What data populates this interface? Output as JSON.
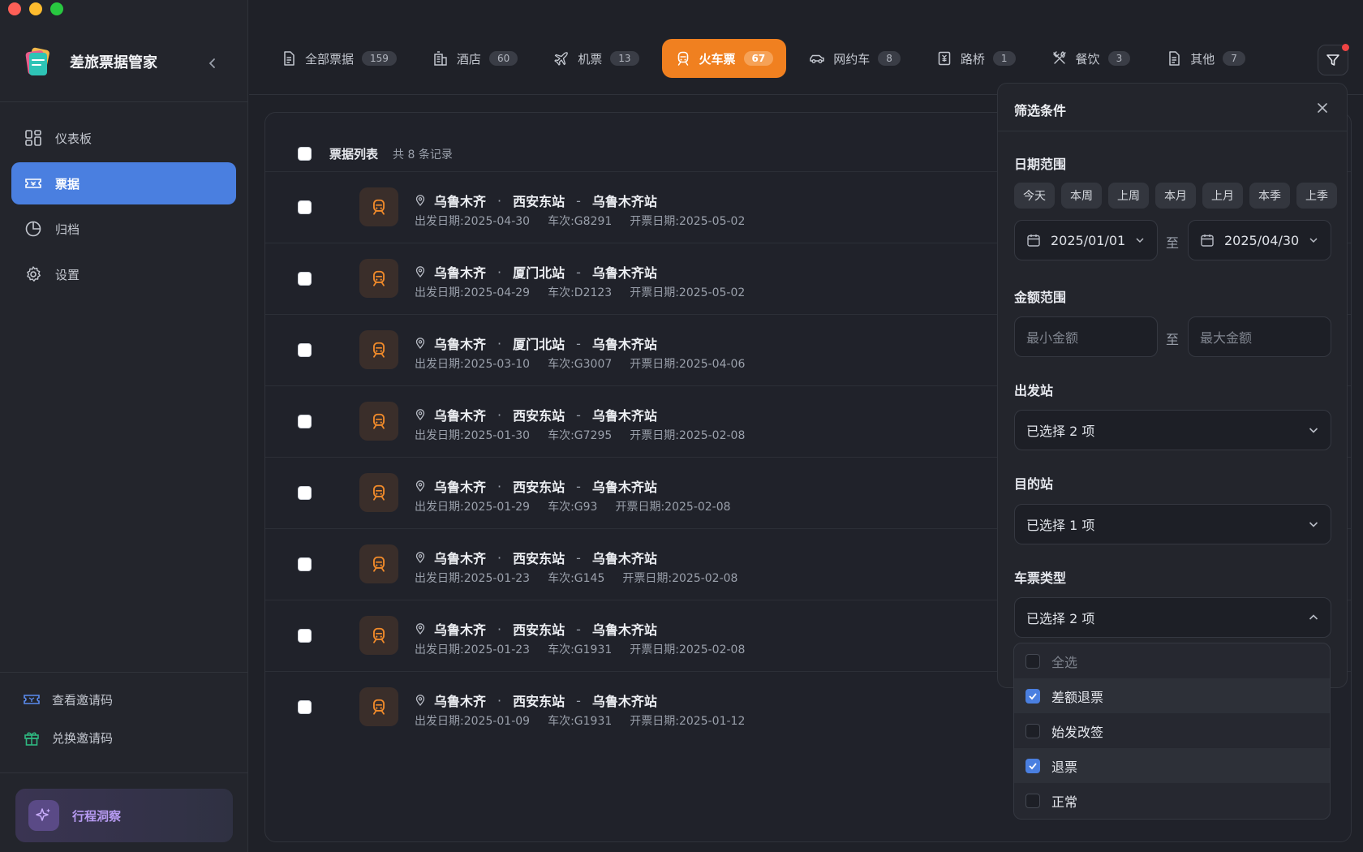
{
  "app": {
    "title": "差旅票据管家"
  },
  "sidebar": {
    "items": [
      {
        "label": "仪表板",
        "icon": "dashboard-icon",
        "active": false
      },
      {
        "label": "票据",
        "icon": "ticket-icon",
        "active": true
      },
      {
        "label": "归档",
        "icon": "pie-icon",
        "active": false
      },
      {
        "label": "设置",
        "icon": "gear-icon",
        "active": false
      }
    ],
    "bottom_links": [
      {
        "label": "查看邀请码",
        "icon": "ticket-icon"
      },
      {
        "label": "兑换邀请码",
        "icon": "gift-icon"
      }
    ],
    "insight_label": "行程洞察"
  },
  "tabs": [
    {
      "label": "全部票据",
      "count": "159",
      "icon": "document-icon",
      "active": false
    },
    {
      "label": "酒店",
      "count": "60",
      "icon": "hotel-icon",
      "active": false
    },
    {
      "label": "机票",
      "count": "13",
      "icon": "plane-icon",
      "active": false
    },
    {
      "label": "火车票",
      "count": "67",
      "icon": "train-icon",
      "active": true
    },
    {
      "label": "网约车",
      "count": "8",
      "icon": "car-icon",
      "active": false
    },
    {
      "label": "路桥",
      "count": "1",
      "icon": "toll-icon",
      "active": false
    },
    {
      "label": "餐饮",
      "count": "3",
      "icon": "utensils-icon",
      "active": false
    },
    {
      "label": "其他",
      "count": "7",
      "icon": "document-icon",
      "active": false
    }
  ],
  "list": {
    "title": "票据列表",
    "count_text": "共 8 条记录",
    "rows": [
      {
        "city": "乌鲁木齐",
        "from": "西安东站",
        "to": "乌鲁木齐站",
        "depart": "出发日期:2025-04-30",
        "train": "车次:G8291",
        "issue": "开票日期:2025-05-02"
      },
      {
        "city": "乌鲁木齐",
        "from": "厦门北站",
        "to": "乌鲁木齐站",
        "depart": "出发日期:2025-04-29",
        "train": "车次:D2123",
        "issue": "开票日期:2025-05-02"
      },
      {
        "city": "乌鲁木齐",
        "from": "厦门北站",
        "to": "乌鲁木齐站",
        "depart": "出发日期:2025-03-10",
        "train": "车次:G3007",
        "issue": "开票日期:2025-04-06"
      },
      {
        "city": "乌鲁木齐",
        "from": "西安东站",
        "to": "乌鲁木齐站",
        "depart": "出发日期:2025-01-30",
        "train": "车次:G7295",
        "issue": "开票日期:2025-02-08"
      },
      {
        "city": "乌鲁木齐",
        "from": "西安东站",
        "to": "乌鲁木齐站",
        "depart": "出发日期:2025-01-29",
        "train": "车次:G93",
        "issue": "开票日期:2025-02-08"
      },
      {
        "city": "乌鲁木齐",
        "from": "西安东站",
        "to": "乌鲁木齐站",
        "depart": "出发日期:2025-01-23",
        "train": "车次:G145",
        "issue": "开票日期:2025-02-08"
      },
      {
        "city": "乌鲁木齐",
        "from": "西安东站",
        "to": "乌鲁木齐站",
        "depart": "出发日期:2025-01-23",
        "train": "车次:G1931",
        "issue": "开票日期:2025-02-08"
      },
      {
        "city": "乌鲁木齐",
        "from": "西安东站",
        "to": "乌鲁木齐站",
        "depart": "出发日期:2025-01-09",
        "train": "车次:G1931",
        "issue": "开票日期:2025-01-12"
      }
    ]
  },
  "filter": {
    "title": "筛选条件",
    "date_label": "日期范围",
    "date_chips": [
      "今天",
      "本周",
      "上周",
      "本月",
      "上月",
      "本季",
      "上季"
    ],
    "date_start": "2025/01/01",
    "date_end": "2025/04/30",
    "to_text": "至",
    "amount_label": "金额范围",
    "amount_min_placeholder": "最小金额",
    "amount_max_placeholder": "最大金额",
    "depart_label": "出发站",
    "depart_value": "已选择 2 项",
    "dest_label": "目的站",
    "dest_value": "已选择 1 项",
    "type_label": "车票类型",
    "type_value": "已选择 2 项",
    "type_options": [
      {
        "label": "全选",
        "checked": false
      },
      {
        "label": "差额退票",
        "checked": true
      },
      {
        "label": "始发改签",
        "checked": false
      },
      {
        "label": "退票",
        "checked": true
      },
      {
        "label": "正常",
        "checked": false
      }
    ]
  },
  "colors": {
    "accent": "#f08020",
    "primary": "#4a7fe0",
    "background": "#1f2128"
  }
}
